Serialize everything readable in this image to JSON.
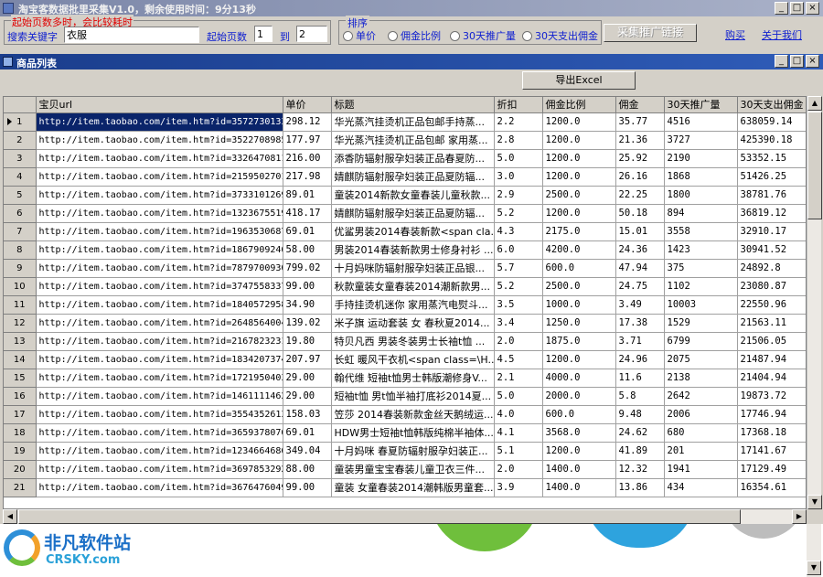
{
  "window": {
    "title": "淘宝客数据批里采集V1.0，剩余使用时间：9分13秒",
    "min": "_",
    "max": "□",
    "close": "×"
  },
  "search": {
    "warning": "起始页数多时，会比较耗时",
    "keyword_label": "搜索关键字",
    "keyword_value": "衣服",
    "start_page_label": "起始页数",
    "start_page_value": "1",
    "to_label": "到",
    "end_page_value": "2"
  },
  "sort": {
    "label": "排序",
    "options": [
      "单价",
      "佣金比例",
      "30天推广量",
      "30天支出佣金"
    ]
  },
  "actions": {
    "collect": "采集推广链接",
    "buy": "购买",
    "about": "关于我们",
    "export": "导出Excel"
  },
  "child": {
    "title": "商品列表",
    "min": "_",
    "max": "□",
    "close": "×"
  },
  "grid": {
    "columns": [
      "宝贝url",
      "单价",
      "标题",
      "折扣",
      "佣金比例",
      "佣金",
      "30天推广量",
      "30天支出佣金"
    ],
    "rows": [
      [
        "1",
        "http://item.taobao.com/item.htm?id=35727301337",
        "298.12",
        "华光蒸汽挂烫机正品包邮手持蒸...",
        "2.2",
        "1200.0",
        "35.77",
        "4516",
        "638059.14"
      ],
      [
        "2",
        "http://item.taobao.com/item.htm?id=35227089852",
        "177.97",
        "华光蒸汽挂烫机正品包邮 家用蒸...",
        "2.8",
        "1200.0",
        "21.36",
        "3727",
        "425390.18"
      ],
      [
        "3",
        "http://item.taobao.com/item.htm?id=3326470811",
        "216.00",
        "添香防辐射服孕妇装正品春夏防...",
        "5.0",
        "1200.0",
        "25.92",
        "2190",
        "53352.15"
      ],
      [
        "4",
        "http://item.taobao.com/item.htm?id=21595027010",
        "217.98",
        "婧麒防辐射服孕妇装正品夏防辐...",
        "3.0",
        "1200.0",
        "26.16",
        "1868",
        "51426.25"
      ],
      [
        "5",
        "http://item.taobao.com/item.htm?id=37331012698",
        "89.01",
        "童装2014新款女童春装儿童秋款...",
        "2.9",
        "2500.0",
        "22.25",
        "1800",
        "38781.76"
      ],
      [
        "6",
        "http://item.taobao.com/item.htm?id=13236755192",
        "418.17",
        "婧麒防辐射服孕妇装正品夏防辐...",
        "5.2",
        "1200.0",
        "50.18",
        "894",
        "36819.12"
      ],
      [
        "7",
        "http://item.taobao.com/item.htm?id=19635306875",
        "69.01",
        "优鲨男装2014春装新款<span cla...",
        "4.3",
        "2175.0",
        "15.01",
        "3558",
        "32910.17"
      ],
      [
        "8",
        "http://item.taobao.com/item.htm?id=18679092469",
        "58.00",
        "男装2014春装新款男士修身衬衫 ...",
        "6.0",
        "4200.0",
        "24.36",
        "1423",
        "30941.52"
      ],
      [
        "9",
        "http://item.taobao.com/item.htm?id=7879700930",
        "799.02",
        "十月妈咪防辐射服孕妇装正品银...",
        "5.7",
        "600.0",
        "47.94",
        "375",
        "24892.8"
      ],
      [
        "10",
        "http://item.taobao.com/item.htm?id=37475583375",
        "99.00",
        "秋款童装女童春装2014潮新款男...",
        "5.2",
        "2500.0",
        "24.75",
        "1102",
        "23080.87"
      ],
      [
        "11",
        "http://item.taobao.com/item.htm?id=18405729588",
        "34.90",
        "手持挂烫机迷你 家用蒸汽电熨斗...",
        "3.5",
        "1000.0",
        "3.49",
        "10003",
        "22550.96"
      ],
      [
        "12",
        "http://item.taobao.com/item.htm?id=26485640046",
        "139.02",
        "米子旗 运动套装 女 春秋夏2014...",
        "3.4",
        "1250.0",
        "17.38",
        "1529",
        "21563.11"
      ],
      [
        "13",
        "http://item.taobao.com/item.htm?id=21678232312",
        "19.80",
        "特贝凡西 男装冬装男士长袖t恤 ...",
        "2.0",
        "1875.0",
        "3.71",
        "6799",
        "21506.05"
      ],
      [
        "14",
        "http://item.taobao.com/item.htm?id=18342073746",
        "207.97",
        "长虹 暖风干衣机<span class=\\H...",
        "4.5",
        "1200.0",
        "24.96",
        "2075",
        "21487.94"
      ],
      [
        "15",
        "http://item.taobao.com/item.htm?id=17219504030",
        "29.00",
        "翰代维 短袖t恤男士韩版潮修身V...",
        "2.1",
        "4000.0",
        "11.6",
        "2138",
        "21404.94"
      ],
      [
        "16",
        "http://item.taobao.com/item.htm?id=14611114626",
        "29.00",
        "短袖t恤 男t恤半袖打底衫2014夏...",
        "5.0",
        "2000.0",
        "5.8",
        "2642",
        "19873.72"
      ],
      [
        "17",
        "http://item.taobao.com/item.htm?id=35543526134",
        "158.03",
        "笠莎 2014春装新款金丝天鹅绒运...",
        "4.0",
        "600.0",
        "9.48",
        "2006",
        "17746.94"
      ],
      [
        "18",
        "http://item.taobao.com/item.htm?id=36593780765",
        "69.01",
        "HDW男士短袖t恤韩版纯棉半袖体...",
        "4.1",
        "3568.0",
        "24.62",
        "680",
        "17368.18"
      ],
      [
        "19",
        "http://item.taobao.com/item.htm?id=12346646868",
        "349.04",
        "十月妈咪 春夏防辐射服孕妇装正...",
        "5.1",
        "1200.0",
        "41.89",
        "201",
        "17141.67"
      ],
      [
        "20",
        "http://item.taobao.com/item.htm?id=36978532923",
        "88.00",
        "童装男童宝宝春装儿童卫衣三件...",
        "2.0",
        "1400.0",
        "12.32",
        "1941",
        "17129.49"
      ],
      [
        "21",
        "http://item.taobao.com/item.htm?id=36764760496",
        "99.00",
        "童装 女童春装2014潮韩版男童套...",
        "3.9",
        "1400.0",
        "13.86",
        "434",
        "16354.61"
      ]
    ]
  },
  "footer": {
    "logo_cn": "非凡软件站",
    "logo_en": "CRSKY.com"
  }
}
